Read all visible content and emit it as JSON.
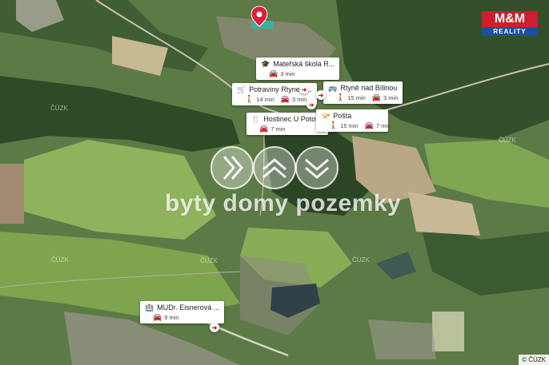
{
  "colors": {
    "pin": "#d91f3a",
    "logo_red": "#cc1f2f",
    "logo_blue": "#1b4fa3"
  },
  "pois": [
    {
      "name": "Mateřská škola R...",
      "icon": "school-icon",
      "walk": "",
      "drive": "3 min"
    },
    {
      "name": "Potraviny Rtyne n...",
      "icon": "cart-icon",
      "walk": "14 min",
      "drive": "3 min"
    },
    {
      "name": "Rtyně nad Bílinou",
      "icon": "bus-icon",
      "walk": "15 min",
      "drive": "3 min"
    },
    {
      "name": "Hostinec U Potoka",
      "icon": "fork-knife-icon",
      "walk": "",
      "drive": "7 min"
    },
    {
      "name": "Pošta",
      "icon": "post-icon",
      "walk": "15 min",
      "drive": "7 min"
    },
    {
      "name": "MUDr. Eisnerová ...",
      "icon": "medical-icon",
      "walk": "",
      "drive": "9 min"
    }
  ],
  "watermark": {
    "text": "byty domy pozemky"
  },
  "logo": {
    "top": "M&M",
    "bottom": "REALITY"
  },
  "cuzk_label": "ČÚZK",
  "copyright": "© ČÚZK"
}
